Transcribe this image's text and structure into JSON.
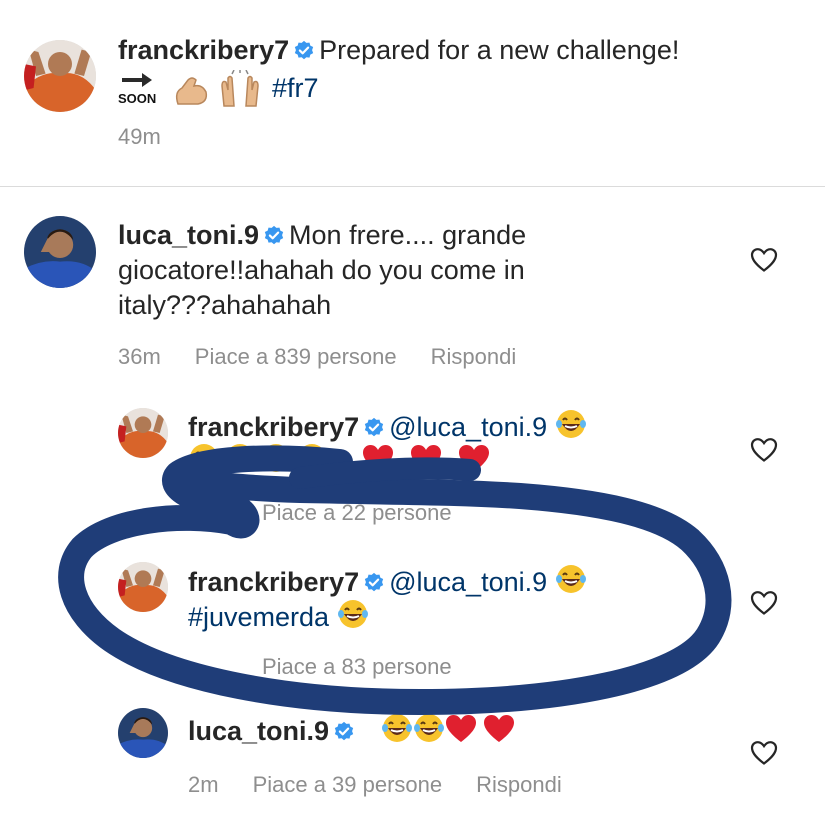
{
  "post": {
    "username": "franckribery7",
    "caption": "Prepared for a new challenge!",
    "soon_label": "SOON",
    "hashtag": "#fr7",
    "time": "49m"
  },
  "comments": [
    {
      "username": "luca_toni.9",
      "line1": "Mon frere.... grande",
      "line2": "giocatore!!ahahah do you come in",
      "line3": "italy???ahahahah",
      "time": "36m",
      "likes": "Piace a 839 persone",
      "reply": "Rispondi"
    }
  ],
  "replies": [
    {
      "username": "franckribery7",
      "mention": "@luca_toni.9",
      "likes": "Piace a 22 persone"
    },
    {
      "username": "franckribery7",
      "mention": "@luca_toni.9",
      "hashtag": "#juvemerda",
      "likes": "Piace a 83 persone"
    },
    {
      "username": "luca_toni.9",
      "time": "2m",
      "likes": "Piace a 39 persone",
      "reply": "Rispondi"
    }
  ],
  "colors": {
    "verified": "#3897f0",
    "meta_text": "#8e8e8e",
    "heart_emoji": "#e0202f",
    "laugh_emoji": "#f7c32c",
    "marker_ink": "#1f3d78"
  },
  "icons": [
    "verified-badge-icon",
    "heart-outline-icon",
    "arrow-right-icon",
    "flexed-biceps-icon",
    "raising-hands-icon",
    "laughing-tears-icon",
    "red-heart-icon"
  ]
}
